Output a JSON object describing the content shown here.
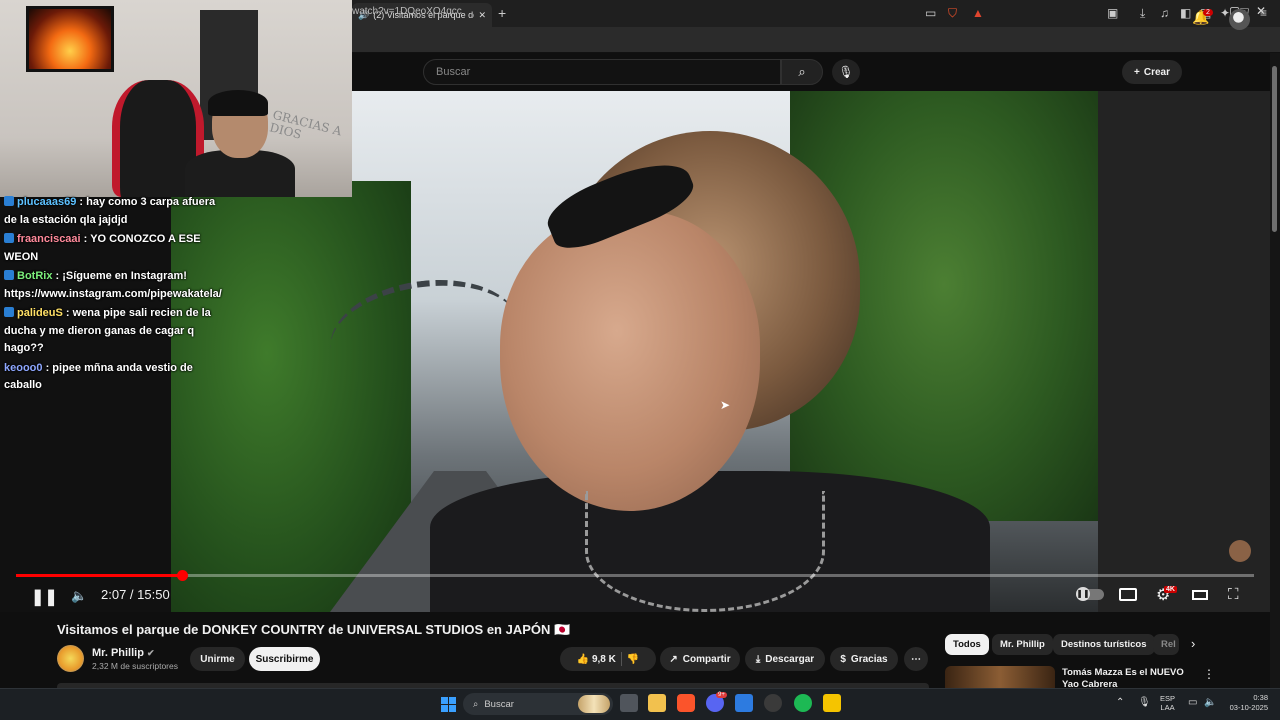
{
  "browser": {
    "tab_title": "(2) Visitamos el parque de D",
    "new_tab": "+",
    "url": "watch?v=1DQeoXO4qcc",
    "window_buttons": [
      "—",
      "▢",
      "✕"
    ]
  },
  "youtube_header": {
    "search_placeholder": "Buscar",
    "create_label": "Crear",
    "notifications_count": "2"
  },
  "webcam": {
    "wall_text": "GRACIAS A DIOS"
  },
  "chat": [
    {
      "user": "plucaaas69",
      "text": ": hay como 3 carpa afuera de la estación qla jajdjd"
    },
    {
      "user": "fraanciscaai",
      "text": ": YO CONOZCO A ESE WEON"
    },
    {
      "user": "BotRix",
      "text": ": ¡Sígueme en Instagram! https://www.instagram.com/pipewakatela/"
    },
    {
      "user": "palideuS",
      "text": ": wena pipe sali recien de la ducha y me dieron ganas de cagar q hago??"
    },
    {
      "user": "keooo0",
      "text": ": pipee mñna anda vestio de caballo"
    }
  ],
  "player": {
    "current_time": "2:07",
    "duration": "15:50",
    "time_display": "2:07 / 15:50",
    "progress_fraction": 0.1337,
    "quality_badge": "4K"
  },
  "video": {
    "title": "Visitamos el parque de DONKEY COUNTRY de UNIVERSAL STUDIOS en JAPÓN 🇯🇵",
    "channel": "Mr. Phillip",
    "subscribers": "2,32 M de suscriptores",
    "join_label": "Unirme",
    "subscribe_label": "Suscribirme",
    "likes": "9,8 K",
    "share_label": "Compartir",
    "download_label": "Descargar",
    "thanks_label": "Gracias"
  },
  "sidebar": {
    "chips": [
      "Todos",
      "Mr. Phillip",
      "Destinos turísticos",
      "Rel"
    ],
    "recommended_title": "Tomás Mazza Es el NUEVO Yao Cabrera"
  },
  "taskbar": {
    "search_label": "Buscar",
    "lang_line1": "ESP",
    "lang_line2": "LAA",
    "time": "0:38",
    "date": "03-10-2025",
    "discord_badge": "9+"
  },
  "colors": {
    "progress": "#ff0000",
    "chat_username": "#5dc1ff",
    "youtube_bg": "#0f0f0f"
  }
}
